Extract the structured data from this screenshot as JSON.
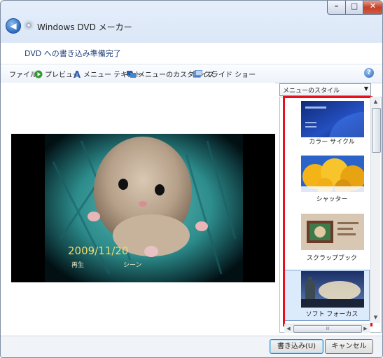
{
  "window": {
    "app_title": "Windows DVD メーカー",
    "controls": {
      "minimize": "–",
      "maximize": "□",
      "close": "✕"
    }
  },
  "header": {
    "title": "DVD への書き込み準備完了"
  },
  "toolbar": {
    "items": [
      {
        "label": "ファイル",
        "icon": "none"
      },
      {
        "label": "プレビュー",
        "icon": "play-icon"
      },
      {
        "label": "メニュー テキスト",
        "icon": "text-A-icon"
      },
      {
        "label": "メニューのカスタマイズ",
        "icon": "customize-icon"
      },
      {
        "label": "スライド ショー",
        "icon": "slideshow-icon"
      }
    ],
    "help_label": "?"
  },
  "preview": {
    "date": "2009/11/20",
    "play": "再生",
    "scenes": "シーン"
  },
  "style_panel": {
    "dropdown_value": "メニューのスタイル",
    "styles": [
      {
        "label": "カラー サイクル"
      },
      {
        "label": "シャッター"
      },
      {
        "label": "スクラップブック"
      },
      {
        "label": "ソフト フォーカス"
      }
    ],
    "selected_index": 3,
    "highlight_color": "#e8101a",
    "hscroll_grip": "III"
  },
  "footer": {
    "burn_button": "書き込み(U)",
    "cancel_button": "キャンセル"
  }
}
